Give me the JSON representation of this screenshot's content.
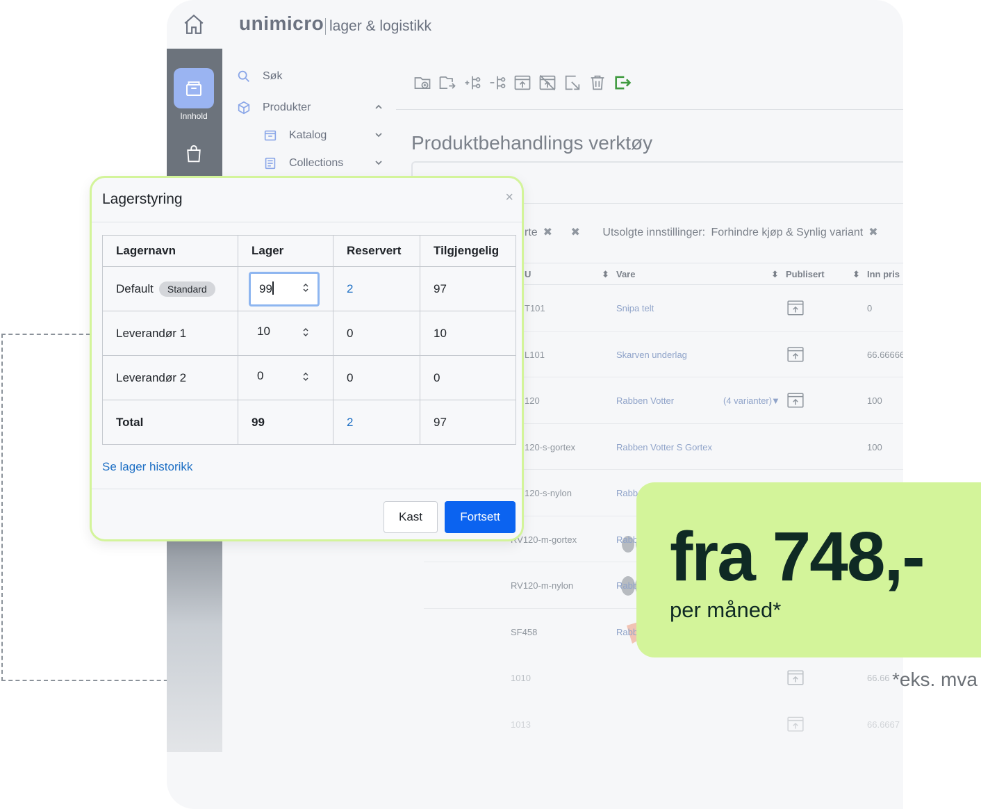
{
  "brand": {
    "name": "unimicro",
    "product": "lager & logistikk"
  },
  "rail": {
    "active_label": "Innhold"
  },
  "nav": {
    "items": [
      {
        "label": "Søk"
      },
      {
        "label": "Produkter"
      },
      {
        "label": "Katalog"
      },
      {
        "label": "Collections"
      }
    ]
  },
  "page": {
    "title": "Produktbehandlings verktøy"
  },
  "filters": {
    "partial_label": "rte",
    "soldout_label": "Utsolgte innstillinger:",
    "soldout_value": "Forhindre kjøp & Synlig variant"
  },
  "product_table": {
    "headers": [
      "U",
      "Vare",
      "Publisert",
      "Inn pris"
    ],
    "rows": [
      {
        "sku": "T101",
        "name": "Snipa telt",
        "variants": "",
        "price": "0"
      },
      {
        "sku": "L101",
        "name": "Skarven underlag",
        "variants": "",
        "price": "66.66666"
      },
      {
        "sku": "120",
        "name": "Rabben Votter",
        "variants": "(4 varianter)",
        "price": "100"
      },
      {
        "sku": "120-s-gortex",
        "name": "Rabben Votter S Gortex",
        "variants": "",
        "price": "100"
      },
      {
        "sku": "120-s-nylon",
        "name": "Rabb",
        "variants": "",
        "price": ""
      },
      {
        "sku": "RV120-m-gortex",
        "name": "Rabb",
        "variants": "",
        "price": ""
      },
      {
        "sku": "RV120-m-nylon",
        "name": "Rabb",
        "variants": "",
        "price": ""
      },
      {
        "sku": "SF458",
        "name": "Rabb",
        "variants": "",
        "price": ""
      },
      {
        "sku": "1010",
        "name": "",
        "variants": "",
        "price": "66.66"
      },
      {
        "sku": "1013",
        "name": "",
        "variants": "",
        "price": "66.6667"
      }
    ]
  },
  "modal": {
    "title": "Lagerstyring",
    "headers": [
      "Lagernavn",
      "Lager",
      "Reservert",
      "Tilgjengelig"
    ],
    "rows": [
      {
        "name": "Default",
        "badge": "Standard",
        "lager": "99",
        "reservert": "2",
        "tilgjengelig": "97"
      },
      {
        "name": "Leverandør 1",
        "lager": "10",
        "reservert": "0",
        "tilgjengelig": "10"
      },
      {
        "name": "Leverandør 2",
        "lager": "0",
        "reservert": "0",
        "tilgjengelig": "0"
      }
    ],
    "total": {
      "name": "Total",
      "lager": "99",
      "reservert": "2",
      "tilgjengelig": "97"
    },
    "history_link": "Se lager historikk",
    "cancel_label": "Kast",
    "continue_label": "Fortsett"
  },
  "promo": {
    "price": "fra 748,-",
    "period": "per måned*",
    "footnote": "*eks. mva"
  },
  "colors": {
    "accent_green": "#d3f49a",
    "primary_blue": "#0b63f0",
    "link_blue": "#1d6fc4",
    "price_text": "#0f2a24"
  }
}
